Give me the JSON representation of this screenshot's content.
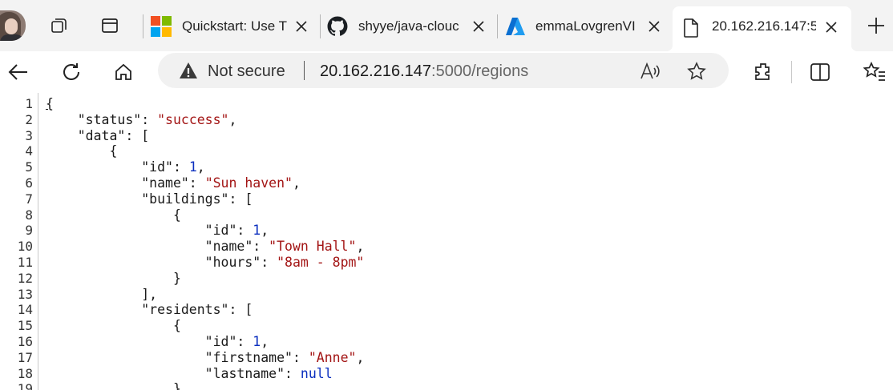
{
  "tabs": [
    {
      "title": "Quickstart: Use T",
      "icon": "microsoft-logo-icon"
    },
    {
      "title": "shyye/java-clouc",
      "icon": "github-icon"
    },
    {
      "title": "emmaLovgrenVI",
      "icon": "azure-icon"
    },
    {
      "title": "20.162.216.147:5",
      "icon": "page-icon",
      "active": true
    }
  ],
  "toolbar": {
    "security_label": "Not secure",
    "url_host": "20.162.216.147",
    "url_rest": ":5000/regions"
  },
  "json_lines": [
    [
      {
        "t": "p",
        "v": "{"
      }
    ],
    [
      {
        "t": "p",
        "v": "    \"status\": "
      },
      {
        "t": "s",
        "v": "\"success\""
      },
      {
        "t": "p",
        "v": ","
      }
    ],
    [
      {
        "t": "p",
        "v": "    \"data\": ["
      }
    ],
    [
      {
        "t": "p",
        "v": "        {"
      }
    ],
    [
      {
        "t": "p",
        "v": "            \"id\": "
      },
      {
        "t": "n",
        "v": "1"
      },
      {
        "t": "p",
        "v": ","
      }
    ],
    [
      {
        "t": "p",
        "v": "            \"name\": "
      },
      {
        "t": "s",
        "v": "\"Sun haven\""
      },
      {
        "t": "p",
        "v": ","
      }
    ],
    [
      {
        "t": "p",
        "v": "            \"buildings\": ["
      }
    ],
    [
      {
        "t": "p",
        "v": "                {"
      }
    ],
    [
      {
        "t": "p",
        "v": "                    \"id\": "
      },
      {
        "t": "n",
        "v": "1"
      },
      {
        "t": "p",
        "v": ","
      }
    ],
    [
      {
        "t": "p",
        "v": "                    \"name\": "
      },
      {
        "t": "s",
        "v": "\"Town Hall\""
      },
      {
        "t": "p",
        "v": ","
      }
    ],
    [
      {
        "t": "p",
        "v": "                    \"hours\": "
      },
      {
        "t": "s",
        "v": "\"8am - 8pm\""
      }
    ],
    [
      {
        "t": "p",
        "v": "                }"
      }
    ],
    [
      {
        "t": "p",
        "v": "            ],"
      }
    ],
    [
      {
        "t": "p",
        "v": "            \"residents\": ["
      }
    ],
    [
      {
        "t": "p",
        "v": "                {"
      }
    ],
    [
      {
        "t": "p",
        "v": "                    \"id\": "
      },
      {
        "t": "n",
        "v": "1"
      },
      {
        "t": "p",
        "v": ","
      }
    ],
    [
      {
        "t": "p",
        "v": "                    \"firstname\": "
      },
      {
        "t": "s",
        "v": "\"Anne\""
      },
      {
        "t": "p",
        "v": ","
      }
    ],
    [
      {
        "t": "p",
        "v": "                    \"lastname\": "
      },
      {
        "t": "k",
        "v": "null"
      }
    ],
    [
      {
        "t": "p",
        "v": "                }"
      }
    ]
  ],
  "line_numbers": [
    "1",
    "2",
    "3",
    "4",
    "5",
    "6",
    "7",
    "8",
    "9",
    "10",
    "11",
    "12",
    "13",
    "14",
    "15",
    "16",
    "17",
    "18",
    "19"
  ],
  "colors": {
    "string": "#a31515",
    "number": "#0b2fbf",
    "keyword": "#0b2fbf",
    "tabstrip": "#f3f3f3"
  }
}
